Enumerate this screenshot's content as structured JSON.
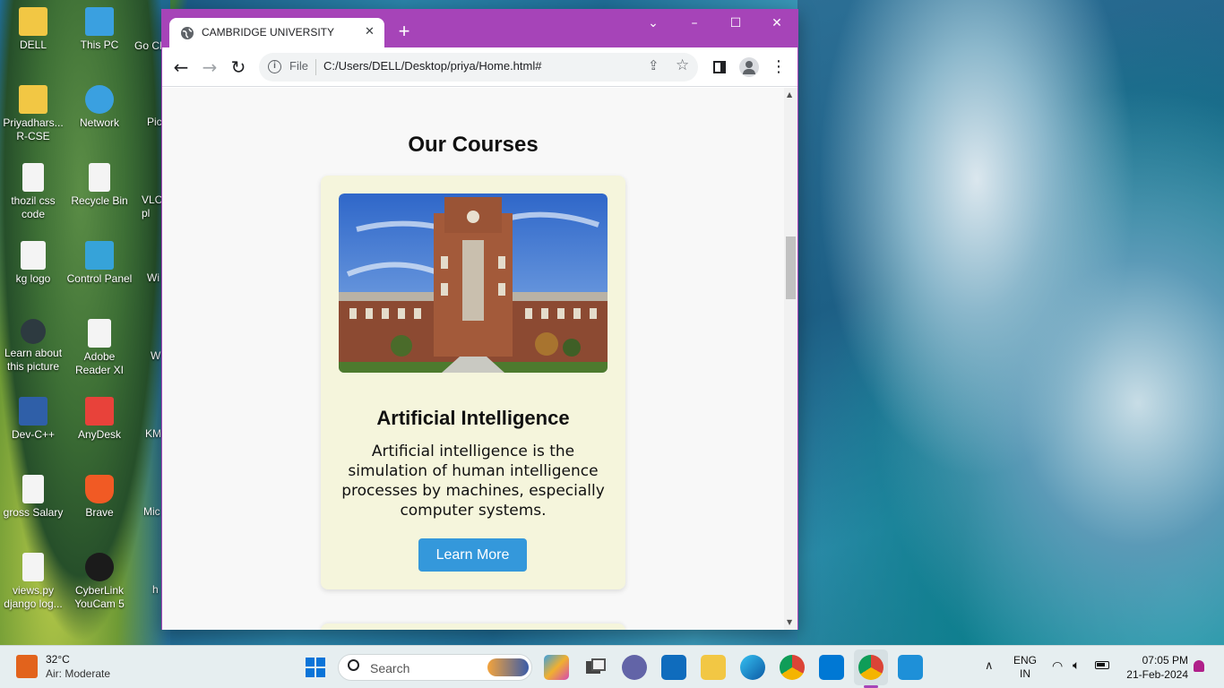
{
  "desktop": {
    "icons": [
      {
        "label": "DELL",
        "color": "#f2c744"
      },
      {
        "label": "This PC",
        "color": "#3aa0e0"
      },
      {
        "label": "Priyadhars... R-CSE",
        "color": "#f2c744"
      },
      {
        "label": "Network",
        "color": "#3aa0e0"
      },
      {
        "label": "thozil css code",
        "color": "#f4f4f4"
      },
      {
        "label": "Recycle Bin",
        "color": "#f4f4f4"
      },
      {
        "label": "kg logo",
        "color": "#f4f4f4"
      },
      {
        "label": "Control Panel",
        "color": "#36a3d9"
      },
      {
        "label": "Learn about this picture",
        "color": "#2d3a40"
      },
      {
        "label": "Adobe Reader XI",
        "color": "#f4f4f4"
      },
      {
        "label": "Dev-C++",
        "color": "#2f5fa8"
      },
      {
        "label": "AnyDesk",
        "color": "#e8423a"
      },
      {
        "label": "gross Salary",
        "color": "#f4f4f4"
      },
      {
        "label": "Brave",
        "color": "#f15a24"
      },
      {
        "label": "views.py django log...",
        "color": "#f4f4f4"
      },
      {
        "label": "CyberLink YouCam 5",
        "color": "#1b1b1b"
      }
    ],
    "partial_icons": [
      "Go Ch",
      "Pic",
      "VLC pl",
      "Wi",
      "W",
      "KM",
      "Mic E",
      "h"
    ]
  },
  "browser": {
    "tab_title": "CAMBRIDGE UNIVERSITY",
    "new_tab": "+",
    "window_controls": {
      "dropdown": "⌄",
      "minimize": "–",
      "maximize": "☐",
      "close": "✕"
    },
    "url_scheme": "File",
    "url": "C:/Users/DELL/Desktop/priya/Home.html#",
    "accent_color": "#a644b8"
  },
  "page": {
    "section_title": "Our Courses",
    "course": {
      "title": "Artificial Intelligence",
      "description": "Artificial intelligence is the simulation of human intelligence processes by machines, especially computer systems.",
      "button_label": "Learn More",
      "card_color": "#f5f5dc",
      "button_color": "#3498db"
    }
  },
  "taskbar": {
    "weather_temp": "32°C",
    "weather_desc": "Air: Moderate",
    "search_placeholder": "Search",
    "language": "ENG",
    "region": "IN",
    "time": "07:05 PM",
    "date": "21-Feb-2024"
  }
}
